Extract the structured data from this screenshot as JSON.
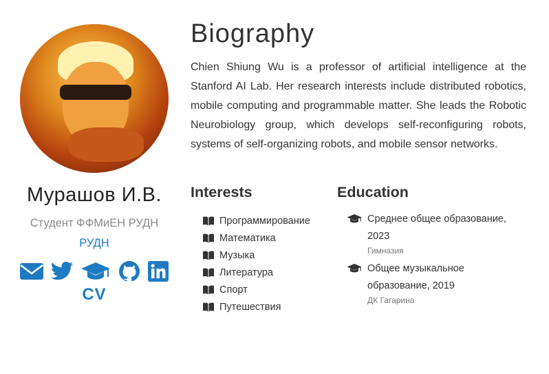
{
  "profile": {
    "name": "Мурашов И.В.",
    "role": "Студент ФФМиЕН РУДН",
    "org": "РУДН",
    "cv": "CV",
    "social_icons": [
      "envelope-icon",
      "twitter-icon",
      "graduation-cap-icon",
      "github-icon",
      "linkedin-icon"
    ]
  },
  "biography": {
    "title": "Biography",
    "text": "Chien Shiung Wu is a professor of artificial intelligence at the Stanford AI Lab. Her research interests include distributed robotics, mobile computing and programmable matter. She leads the Robotic Neurobiology group, which develops self-reconfiguring robots, systems of self-organizing robots, and mobile sensor networks."
  },
  "interests": {
    "title": "Interests",
    "items": [
      "Программирование",
      "Математика",
      "Музыка",
      "Литература",
      "Спорт",
      "Путешествия"
    ]
  },
  "education": {
    "title": "Education",
    "items": [
      {
        "course": "Среднее общее образование, 2023",
        "institution": "Гимназия"
      },
      {
        "course": "Общее музыкальное образование, 2019",
        "institution": "ДК Гагарина"
      }
    ]
  },
  "colors": {
    "accent": "#1f7bc1",
    "text": "#333333",
    "muted": "#8a8a8a"
  }
}
